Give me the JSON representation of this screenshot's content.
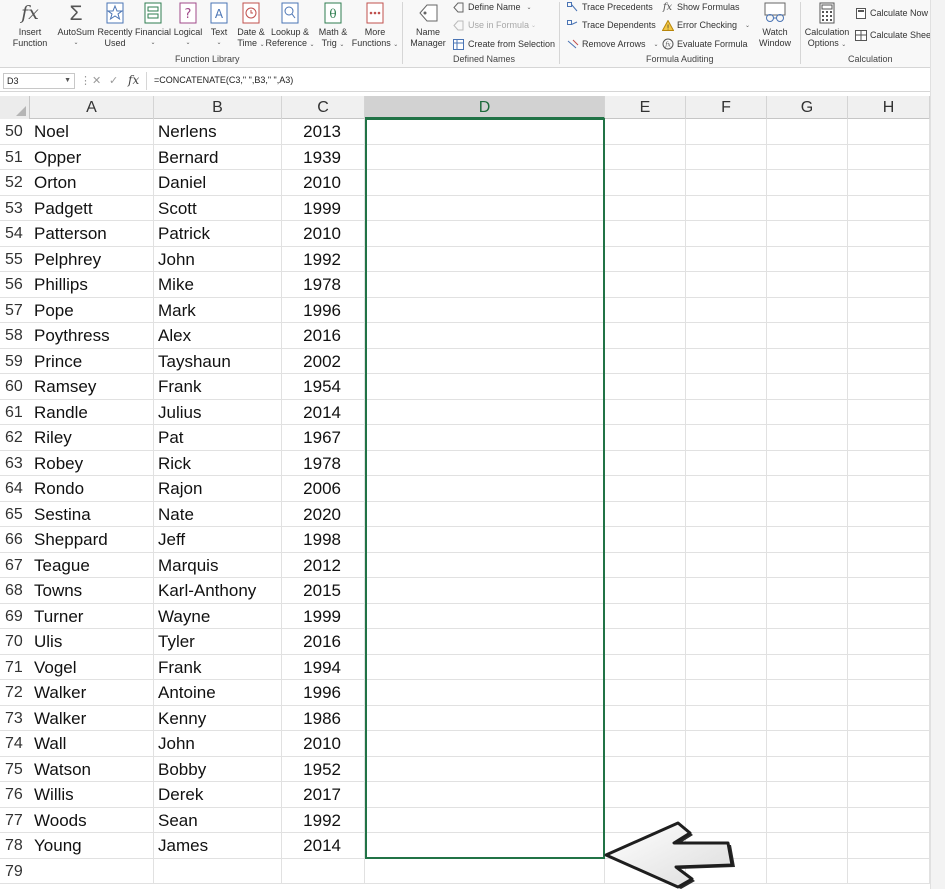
{
  "ribbon": {
    "function_library": {
      "insert_function": {
        "line1": "Insert",
        "line2": "Function",
        "icon": "fx-icon"
      },
      "autosum": {
        "line1": "AutoSum",
        "icon": "sigma-icon"
      },
      "recently_used": {
        "line1": "Recently",
        "line2": "Used",
        "icon": "star-icon"
      },
      "financial": {
        "line1": "Financial",
        "icon": "financial-book-icon"
      },
      "logical": {
        "line1": "Logical",
        "icon": "question-book-icon"
      },
      "text": {
        "line1": "Text",
        "icon": "text-book-icon"
      },
      "date_time": {
        "line1": "Date &",
        "line2": "Time",
        "icon": "clock-book-icon"
      },
      "lookup_reference": {
        "line1": "Lookup &",
        "line2": "Reference",
        "icon": "search-book-icon"
      },
      "math_trig": {
        "line1": "Math &",
        "line2": "Trig",
        "icon": "theta-book-icon"
      },
      "more_functions": {
        "line1": "More",
        "line2": "Functions",
        "icon": "more-book-icon"
      },
      "group_label": "Function Library"
    },
    "defined_names": {
      "name_manager": {
        "line1": "Name",
        "line2": "Manager",
        "icon": "name-tag-icon"
      },
      "define_name": "Define Name",
      "use_in_formula": "Use in Formula",
      "create_from_selection": "Create from Selection",
      "group_label": "Defined Names"
    },
    "formula_auditing": {
      "trace_precedents": "Trace Precedents",
      "trace_dependents": "Trace Dependents",
      "remove_arrows": "Remove Arrows",
      "show_formulas": "Show Formulas",
      "error_checking": "Error Checking",
      "evaluate_formula": "Evaluate Formula",
      "watch_window": {
        "line1": "Watch",
        "line2": "Window",
        "icon": "glasses-icon"
      },
      "group_label": "Formula Auditing"
    },
    "calculation": {
      "calculation_options": {
        "line1": "Calculation",
        "line2": "Options",
        "icon": "calculator-icon"
      },
      "calculate_now": "Calculate Now",
      "calculate_sheet": "Calculate Sheet",
      "group_label": "Calculation"
    },
    "chevron": "⌄"
  },
  "formula_bar": {
    "name_box": "D3",
    "fx": "fx",
    "formula": "=CONCATENATE(C3,\" \",B3,\" \",A3)"
  },
  "columns": [
    "A",
    "B",
    "C",
    "D",
    "E",
    "F",
    "G",
    "H"
  ],
  "selected_column": "D",
  "rows": [
    {
      "num": "50",
      "a": "Noel",
      "b": "Nerlens",
      "c": "2013"
    },
    {
      "num": "51",
      "a": "Opper",
      "b": "Bernard",
      "c": "1939"
    },
    {
      "num": "52",
      "a": "Orton",
      "b": "Daniel",
      "c": "2010"
    },
    {
      "num": "53",
      "a": "Padgett",
      "b": "Scott",
      "c": "1999"
    },
    {
      "num": "54",
      "a": "Patterson",
      "b": "Patrick",
      "c": "2010"
    },
    {
      "num": "55",
      "a": "Pelphrey",
      "b": "John",
      "c": "1992"
    },
    {
      "num": "56",
      "a": "Phillips",
      "b": "Mike",
      "c": "1978"
    },
    {
      "num": "57",
      "a": "Pope",
      "b": "Mark",
      "c": "1996"
    },
    {
      "num": "58",
      "a": "Poythress",
      "b": "Alex",
      "c": "2016"
    },
    {
      "num": "59",
      "a": "Prince",
      "b": "Tayshaun",
      "c": "2002"
    },
    {
      "num": "60",
      "a": "Ramsey",
      "b": "Frank",
      "c": "1954"
    },
    {
      "num": "61",
      "a": "Randle",
      "b": "Julius",
      "c": "2014"
    },
    {
      "num": "62",
      "a": "Riley",
      "b": "Pat",
      "c": "1967"
    },
    {
      "num": "63",
      "a": "Robey",
      "b": "Rick",
      "c": "1978"
    },
    {
      "num": "64",
      "a": "Rondo",
      "b": "Rajon",
      "c": "2006"
    },
    {
      "num": "65",
      "a": "Sestina",
      "b": "Nate",
      "c": "2020"
    },
    {
      "num": "66",
      "a": "Sheppard",
      "b": "Jeff",
      "c": "1998"
    },
    {
      "num": "67",
      "a": "Teague",
      "b": "Marquis",
      "c": "2012"
    },
    {
      "num": "68",
      "a": "Towns",
      "b": "Karl-Anthony",
      "c": "2015"
    },
    {
      "num": "69",
      "a": "Turner",
      "b": "Wayne",
      "c": "1999"
    },
    {
      "num": "70",
      "a": "Ulis",
      "b": "Tyler",
      "c": "2016"
    },
    {
      "num": "71",
      "a": "Vogel",
      "b": "Frank",
      "c": "1994"
    },
    {
      "num": "72",
      "a": "Walker",
      "b": "Antoine",
      "c": "1996"
    },
    {
      "num": "73",
      "a": "Walker",
      "b": "Kenny",
      "c": "1986"
    },
    {
      "num": "74",
      "a": "Wall",
      "b": "John",
      "c": "2010"
    },
    {
      "num": "75",
      "a": "Watson",
      "b": "Bobby",
      "c": "1952"
    },
    {
      "num": "76",
      "a": "Willis",
      "b": "Derek",
      "c": "2017"
    },
    {
      "num": "77",
      "a": "Woods",
      "b": "Sean",
      "c": "1992"
    },
    {
      "num": "78",
      "a": "Young",
      "b": "James",
      "c": "2014"
    },
    {
      "num": "79",
      "a": "",
      "b": "",
      "c": ""
    }
  ],
  "colors": {
    "selection": "#217346",
    "header_bg": "#f0f0f0"
  }
}
